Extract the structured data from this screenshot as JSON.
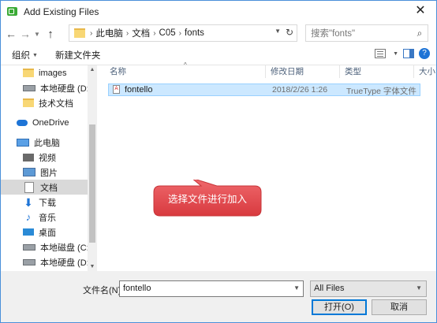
{
  "window": {
    "title": "Add Existing Files",
    "close_glyph": "✕"
  },
  "nav": {
    "breadcrumbs": [
      "此电脑",
      "文档",
      "C05",
      "fonts"
    ],
    "search_placeholder": "搜索\"fonts\""
  },
  "toolbar": {
    "organize": "组织",
    "new_folder": "新建文件夹"
  },
  "sidebar": {
    "items": [
      {
        "label": "images",
        "icon": "folder-icon"
      },
      {
        "label": "本地硬盘 (D:)",
        "icon": "drive-icon"
      },
      {
        "label": "技术文档",
        "icon": "folder-icon"
      },
      {
        "label": "OneDrive",
        "icon": "cloud-icon"
      },
      {
        "label": "此电脑",
        "icon": "computer-icon"
      },
      {
        "label": "视频",
        "icon": "video-icon"
      },
      {
        "label": "图片",
        "icon": "pictures-icon"
      },
      {
        "label": "文档",
        "icon": "document-icon",
        "selected": true
      },
      {
        "label": "下载",
        "icon": "download-icon"
      },
      {
        "label": "音乐",
        "icon": "music-icon"
      },
      {
        "label": "桌面",
        "icon": "desktop-icon"
      },
      {
        "label": "本地磁盘 (C:)",
        "icon": "drive-icon"
      },
      {
        "label": "本地硬盘 (D:)",
        "icon": "drive-icon"
      }
    ]
  },
  "columns": {
    "name": "名称",
    "date": "修改日期",
    "type": "类型",
    "size": "大小"
  },
  "files": [
    {
      "name": "fontello",
      "date": "2018/2/26 1:26",
      "type": "TrueType 字体文件"
    }
  ],
  "callout": {
    "text": "选择文件进行加入",
    "color": "#e8474c"
  },
  "bottom": {
    "filename_label": "文件名(N):",
    "filename_value": "fontello",
    "filter_value": "All Files",
    "open_button": "打开(O)",
    "cancel_button": "取消"
  },
  "colors": {
    "accent": "#0078d7",
    "selection": "#cce8ff"
  }
}
